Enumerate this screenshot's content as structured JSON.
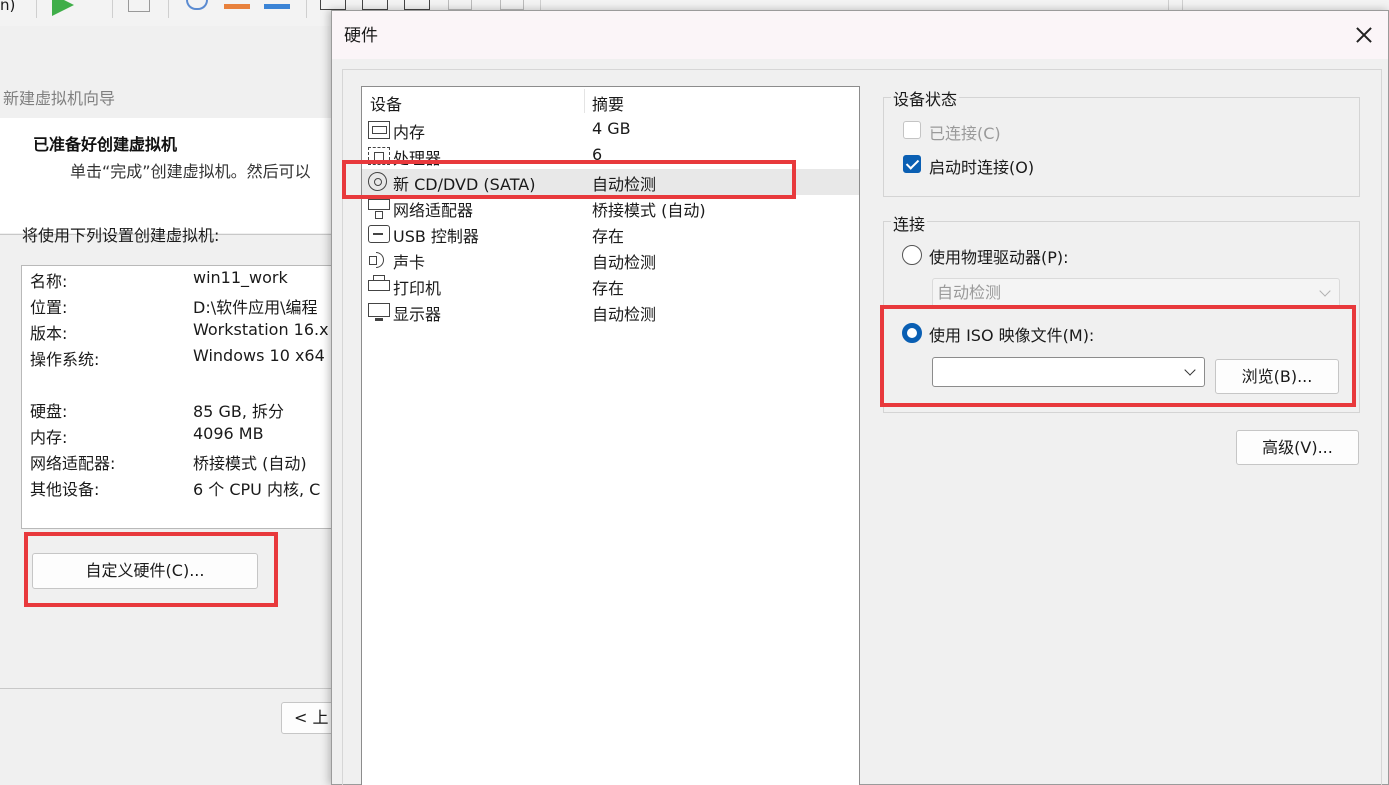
{
  "toolbar": {
    "fragment": "n)"
  },
  "wizard": {
    "title": "新建虚拟机向导",
    "header_title": "已准备好创建虚拟机",
    "header_subtitle": "单击“完成”创建虚拟机。然后可以",
    "intro": "将使用下列设置创建虚拟机:",
    "summary": [
      {
        "key": "名称:",
        "value": "win11_work"
      },
      {
        "key": "位置:",
        "value": "D:\\软件应用\\编程"
      },
      {
        "key": "版本:",
        "value": "Workstation 16.x"
      },
      {
        "key": "操作系统:",
        "value": "Windows 10 x64"
      },
      {
        "key": "硬盘:",
        "value": "85 GB, 拆分"
      },
      {
        "key": "内存:",
        "value": "4096 MB"
      },
      {
        "key": "网络适配器:",
        "value": "桥接模式 (自动)"
      },
      {
        "key": "其他设备:",
        "value": "6 个 CPU 内核, C"
      }
    ],
    "customize_button": "自定义硬件(C)...",
    "prev_button": "< 上"
  },
  "dialog": {
    "title": "硬件",
    "columns": {
      "device": "设备",
      "summary": "摘要"
    },
    "devices": [
      {
        "icon": "memory-icon",
        "name": "内存",
        "summary": "4 GB"
      },
      {
        "icon": "processor-icon",
        "name": "处理器",
        "summary": "6"
      },
      {
        "icon": "cd-dvd-icon",
        "name": "新 CD/DVD (SATA)",
        "summary": "自动检测",
        "selected": true
      },
      {
        "icon": "network-adapter-icon",
        "name": "网络适配器",
        "summary": "桥接模式 (自动)"
      },
      {
        "icon": "usb-icon",
        "name": "USB 控制器",
        "summary": "存在"
      },
      {
        "icon": "sound-card-icon",
        "name": "声卡",
        "summary": "自动检测"
      },
      {
        "icon": "printer-icon",
        "name": "打印机",
        "summary": "存在"
      },
      {
        "icon": "display-icon",
        "name": "显示器",
        "summary": "自动检测"
      }
    ],
    "device_status": {
      "label": "设备状态",
      "connected": {
        "label": "已连接(C)",
        "checked": false,
        "enabled": false
      },
      "connect_at_power_on": {
        "label": "启动时连接(O)",
        "checked": true,
        "enabled": true
      }
    },
    "connection": {
      "label": "连接",
      "use_physical": {
        "label": "使用物理驱动器(P):",
        "selected": false
      },
      "physical_drive_value": "自动检测",
      "use_iso": {
        "label": "使用 ISO 映像文件(M):",
        "selected": true
      },
      "iso_path": "",
      "browse_button": "浏览(B)..."
    },
    "advanced_button": "高级(V)..."
  },
  "colors": {
    "accent": "#0a5fb3",
    "highlight": "#e8393c",
    "selected_row": "#e8e8e8"
  }
}
